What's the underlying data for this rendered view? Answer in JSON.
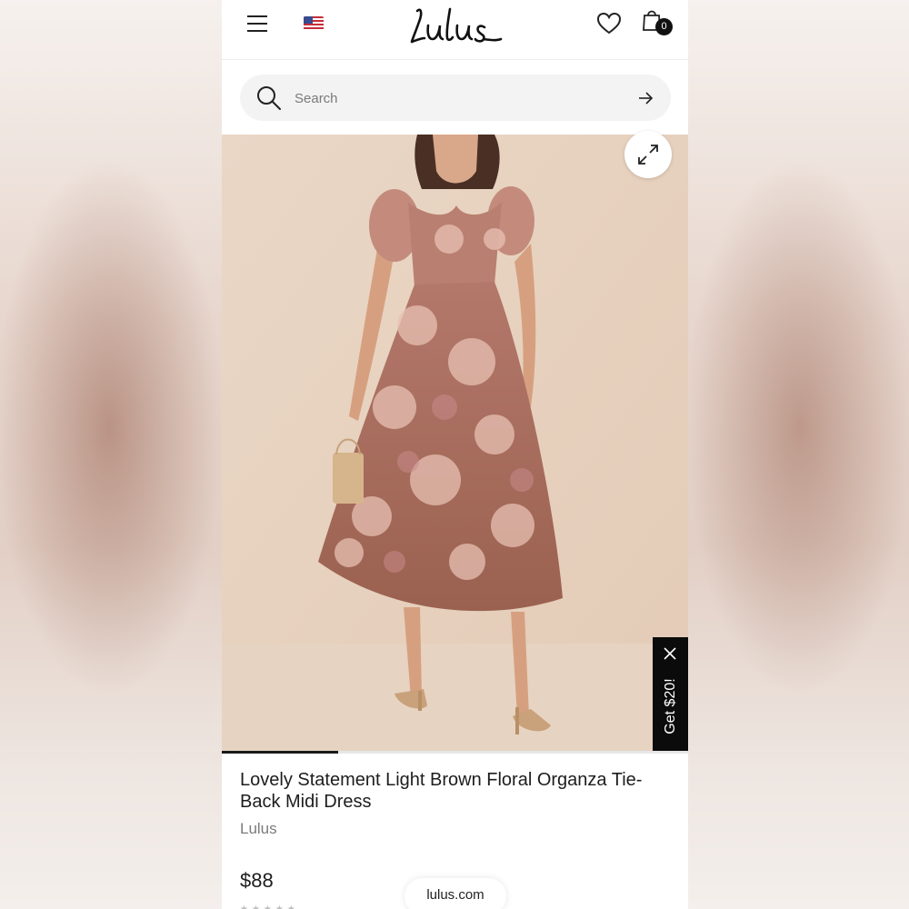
{
  "header": {
    "menu_icon": "hamburger-menu-icon",
    "flag_icon": "us-flag-icon",
    "logo_text": "Lulus",
    "wishlist_icon": "heart-icon",
    "bag_icon": "shopping-bag-icon",
    "bag_count": "0"
  },
  "search": {
    "placeholder": "Search",
    "value": "",
    "icon": "search-icon",
    "submit_icon": "arrow-right-icon"
  },
  "gallery": {
    "expand_icon": "expand-icon",
    "progress": 0.25
  },
  "promo": {
    "label": "Get $20!",
    "close_icon": "close-icon"
  },
  "product": {
    "title": "Lovely Statement Light Brown Floral Organza Tie-Back Midi Dress",
    "brand": "Lulus",
    "price": "$88"
  },
  "browser": {
    "url": "lulus.com"
  },
  "colors": {
    "accent": "#111111",
    "search_bg": "#f3f3f3"
  }
}
